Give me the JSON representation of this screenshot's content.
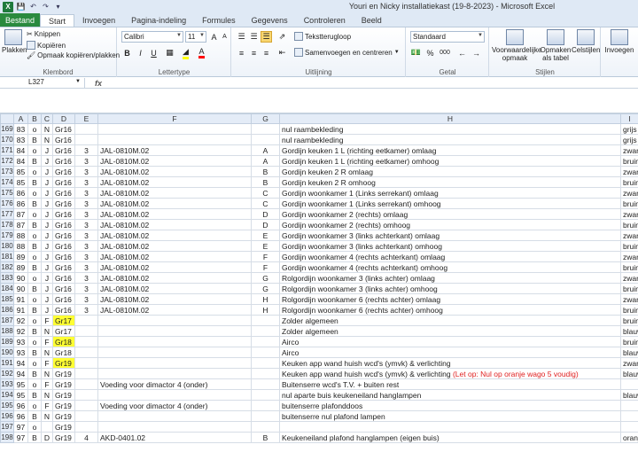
{
  "window": {
    "title": "Youri en Nicky installatiekast (19-8-2023)  -  Microsoft Excel",
    "app_logo": "X"
  },
  "tabs": {
    "file": "Bestand",
    "items": [
      "Start",
      "Invoegen",
      "Pagina-indeling",
      "Formules",
      "Gegevens",
      "Controleren",
      "Beeld"
    ]
  },
  "ribbon": {
    "clipboard": {
      "paste": "Plakken",
      "cut": "Knippen",
      "copy": "Kopiëren",
      "format_painter": "Opmaak kopiëren/plakken",
      "label": "Klembord"
    },
    "font": {
      "name": "Calibri",
      "size": "11",
      "label": "Lettertype",
      "bold": "B",
      "italic": "I",
      "underline": "U",
      "grow": "A",
      "shrink": "A"
    },
    "alignment": {
      "wrap": "Tekstterugloop",
      "merge": "Samenvoegen en centreren",
      "label": "Uitlijning"
    },
    "number": {
      "format": "Standaard",
      "label": "Getal",
      "percent": "%",
      "thousands": "000"
    },
    "styles": {
      "conditional": "Voorwaardelijke opmaak",
      "as_table": "Opmaken als tabel",
      "cell_styles": "Celstijlen",
      "label": "Stijlen"
    },
    "cells": {
      "insert": "Invoegen"
    }
  },
  "formula_bar": {
    "name_box": "L327",
    "fx": "fx",
    "content": ""
  },
  "columns": [
    "A",
    "B",
    "C",
    "D",
    "E",
    "F",
    "G",
    "H",
    "I"
  ],
  "rows": [
    {
      "rn": "169",
      "a": "83",
      "b": "o",
      "c": "N",
      "d": "Gr16",
      "e": "",
      "f": "",
      "g": "",
      "h": "nul raambekleding",
      "i": "grijs"
    },
    {
      "rn": "170",
      "a": "83",
      "b": "B",
      "c": "N",
      "d": "Gr16",
      "e": "",
      "f": "",
      "g": "",
      "h": "nul raambekleding",
      "i": "grijs"
    },
    {
      "rn": "171",
      "a": "84",
      "b": "o",
      "c": "J",
      "d": "Gr16",
      "e": "3",
      "f": "JAL-0810M.02",
      "g": "A",
      "h": "Gordijn keuken 1 L (richting eetkamer)  omlaag",
      "i": "zwart"
    },
    {
      "rn": "172",
      "a": "84",
      "b": "B",
      "c": "J",
      "d": "Gr16",
      "e": "3",
      "f": "JAL-0810M.02",
      "g": "A",
      "h": "Gordijn keuken 1 L (richting eetkamer)  omhoog",
      "i": "bruin"
    },
    {
      "rn": "173",
      "a": "85",
      "b": "o",
      "c": "J",
      "d": "Gr16",
      "e": "3",
      "f": "JAL-0810M.02",
      "g": "B",
      "h": "Gordijn keuken 2 R  omlaag",
      "i": "zwart"
    },
    {
      "rn": "174",
      "a": "85",
      "b": "B",
      "c": "J",
      "d": "Gr16",
      "e": "3",
      "f": "JAL-0810M.02",
      "g": "B",
      "h": "Gordijn keuken 2 R  omhoog",
      "i": "bruin"
    },
    {
      "rn": "175",
      "a": "86",
      "b": "o",
      "c": "J",
      "d": "Gr16",
      "e": "3",
      "f": "JAL-0810M.02",
      "g": "C",
      "h": "Gordijn woonkamer 1 (Links serrekant)  omlaag",
      "i": "zwart"
    },
    {
      "rn": "176",
      "a": "86",
      "b": "B",
      "c": "J",
      "d": "Gr16",
      "e": "3",
      "f": "JAL-0810M.02",
      "g": "C",
      "h": "Gordijn woonkamer 1 (Links serrekant)  omhoog",
      "i": "bruin"
    },
    {
      "rn": "177",
      "a": "87",
      "b": "o",
      "c": "J",
      "d": "Gr16",
      "e": "3",
      "f": "JAL-0810M.02",
      "g": "D",
      "h": "Gordijn woonkamer 2 (rechts)  omlaag",
      "i": "zwart"
    },
    {
      "rn": "178",
      "a": "87",
      "b": "B",
      "c": "J",
      "d": "Gr16",
      "e": "3",
      "f": "JAL-0810M.02",
      "g": "D",
      "h": "Gordijn woonkamer 2 (rechts)  omhoog",
      "i": "bruin"
    },
    {
      "rn": "179",
      "a": "88",
      "b": "o",
      "c": "J",
      "d": "Gr16",
      "e": "3",
      "f": "JAL-0810M.02",
      "g": "E",
      "h": "Gordijn woonkamer 3 (links achterkant)  omlaag",
      "i": "zwart"
    },
    {
      "rn": "180",
      "a": "88",
      "b": "B",
      "c": "J",
      "d": "Gr16",
      "e": "3",
      "f": "JAL-0810M.02",
      "g": "E",
      "h": "Gordijn woonkamer 3 (links achterkant)  omhoog",
      "i": "bruin"
    },
    {
      "rn": "181",
      "a": "89",
      "b": "o",
      "c": "J",
      "d": "Gr16",
      "e": "3",
      "f": "JAL-0810M.02",
      "g": "F",
      "h": "Gordijn woonkamer 4 (rechts achterkant)  omlaag",
      "i": "zwart"
    },
    {
      "rn": "182",
      "a": "89",
      "b": "B",
      "c": "J",
      "d": "Gr16",
      "e": "3",
      "f": "JAL-0810M.02",
      "g": "F",
      "h": "Gordijn woonkamer 4 (rechts achterkant)  omhoog",
      "i": "bruin"
    },
    {
      "rn": "183",
      "a": "90",
      "b": "o",
      "c": "J",
      "d": "Gr16",
      "e": "3",
      "f": "JAL-0810M.02",
      "g": "G",
      "h": "Rolgordijn woonkamer 3 (links achter)  omlaag",
      "i": "zwart"
    },
    {
      "rn": "184",
      "a": "90",
      "b": "B",
      "c": "J",
      "d": "Gr16",
      "e": "3",
      "f": "JAL-0810M.02",
      "g": "G",
      "h": "Rolgordijn woonkamer 3 (links achter)  omhoog",
      "i": "bruin"
    },
    {
      "rn": "185",
      "a": "91",
      "b": "o",
      "c": "J",
      "d": "Gr16",
      "e": "3",
      "f": "JAL-0810M.02",
      "g": "H",
      "h": "Rolgordijn woonkamer 6 (rechts achter)  omlaag",
      "i": "zwart"
    },
    {
      "rn": "186",
      "a": "91",
      "b": "B",
      "c": "J",
      "d": "Gr16",
      "e": "3",
      "f": "JAL-0810M.02",
      "g": "H",
      "h": "Rolgordijn woonkamer 6 (rechts achter)  omhoog",
      "i": "bruin"
    },
    {
      "rn": "187",
      "a": "92",
      "b": "o",
      "c": "F",
      "d": "Gr17",
      "e": "",
      "f": "",
      "g": "",
      "h": "Zolder algemeen",
      "i": "bruin",
      "hl": true
    },
    {
      "rn": "188",
      "a": "92",
      "b": "B",
      "c": "N",
      "d": "Gr17",
      "e": "",
      "f": "",
      "g": "",
      "h": "Zolder algemeen",
      "i": "blauw"
    },
    {
      "rn": "189",
      "a": "93",
      "b": "o",
      "c": "F",
      "d": "Gr18",
      "e": "",
      "f": "",
      "g": "",
      "h": "Airco",
      "i": "bruin",
      "hl": true
    },
    {
      "rn": "190",
      "a": "93",
      "b": "B",
      "c": "N",
      "d": "Gr18",
      "e": "",
      "f": "",
      "g": "",
      "h": "Airco",
      "i": "blauw"
    },
    {
      "rn": "191",
      "a": "94",
      "b": "o",
      "c": "F",
      "d": "Gr19",
      "e": "",
      "f": "",
      "g": "",
      "h": "Keuken app wand huish wcd's (ymvk) & verlichting",
      "i": "zwart",
      "hl": true
    },
    {
      "rn": "192",
      "a": "94",
      "b": "B",
      "c": "N",
      "d": "Gr19",
      "e": "",
      "f": "",
      "g": "",
      "h": "Keuken app wand huish wcd's (ymvk) & verlichting",
      "h_warn": " (Let op: Nul op oranje wago 5 voudig)",
      "i": "blauw"
    },
    {
      "rn": "193",
      "a": "95",
      "b": "o",
      "c": "F",
      "d": "Gr19",
      "e": "",
      "f": "Voeding voor dimactor 4 (onder)",
      "g": "",
      "h": "Buitenserre wcd's T.V. + buiten rest",
      "i": ""
    },
    {
      "rn": "194",
      "a": "95",
      "b": "B",
      "c": "N",
      "d": "Gr19",
      "e": "",
      "f": "",
      "g": "",
      "h": "nul aparte buis keukeneiland hanglampen",
      "i": "blauw"
    },
    {
      "rn": "195",
      "a": "96",
      "b": "o",
      "c": "F",
      "d": "Gr19",
      "e": "",
      "f": "Voeding voor dimactor 4 (onder)",
      "g": "",
      "h": "buitenserre plafonddoos",
      "i": ""
    },
    {
      "rn": "196",
      "a": "96",
      "b": "B",
      "c": "N",
      "d": "Gr19",
      "e": "",
      "f": "",
      "g": "",
      "h": "buitenserre nul plafond lampen",
      "i": ""
    },
    {
      "rn": "197",
      "a": "97",
      "b": "o",
      "c": "",
      "d": "Gr19",
      "e": "",
      "f": "",
      "g": "",
      "h": "",
      "i": ""
    },
    {
      "rn": "198",
      "a": "97",
      "b": "B",
      "c": "D",
      "d": "Gr19",
      "e": "4",
      "f": "AKD-0401.02",
      "g": "B",
      "h": "Keukeneiland plafond hanglampen (eigen buis)",
      "i": "oranje"
    }
  ]
}
